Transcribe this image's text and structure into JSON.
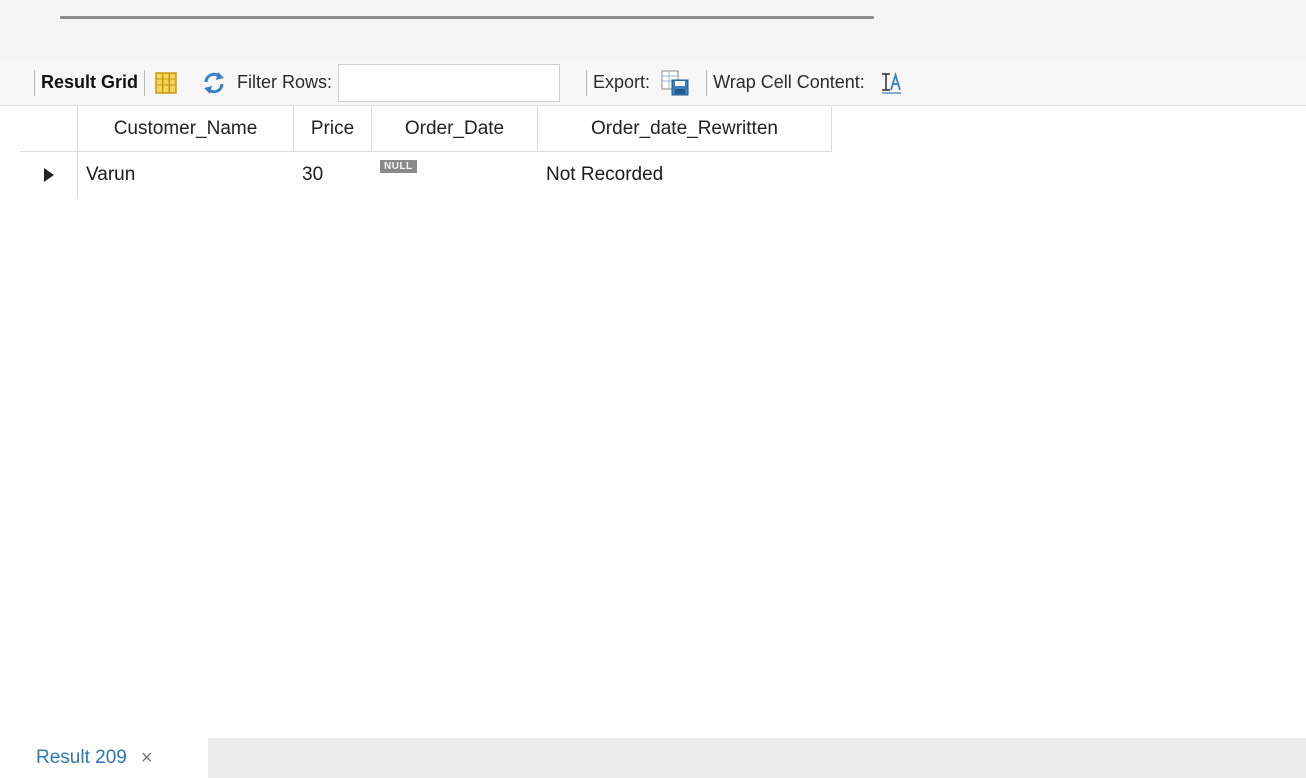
{
  "toolbar": {
    "result_grid_label": "Result Grid",
    "filter_rows_label": "Filter Rows:",
    "filter_rows_value": "",
    "export_label": "Export:",
    "wrap_cell_label": "Wrap Cell Content:"
  },
  "grid": {
    "columns": [
      "Customer_Name",
      "Price",
      "Order_Date",
      "Order_date_Rewritten"
    ],
    "rows": [
      {
        "customer_name": "Varun",
        "price": "30",
        "order_date": "NULL",
        "order_date_rewritten": "Not Recorded"
      }
    ]
  },
  "bottom_tabs": [
    {
      "label": "Result 209",
      "close": "×"
    }
  ],
  "icons": {
    "form_view": "grid-columns-icon",
    "refresh": "refresh-icon",
    "export": "export-icon",
    "wrap": "wrap-text-icon",
    "row_indicator": "current-row-arrow-icon"
  },
  "colors": {
    "tab_text": "#2a7ab0",
    "icon_yellow": "#e8b418",
    "icon_blue": "#3a7fc2"
  }
}
